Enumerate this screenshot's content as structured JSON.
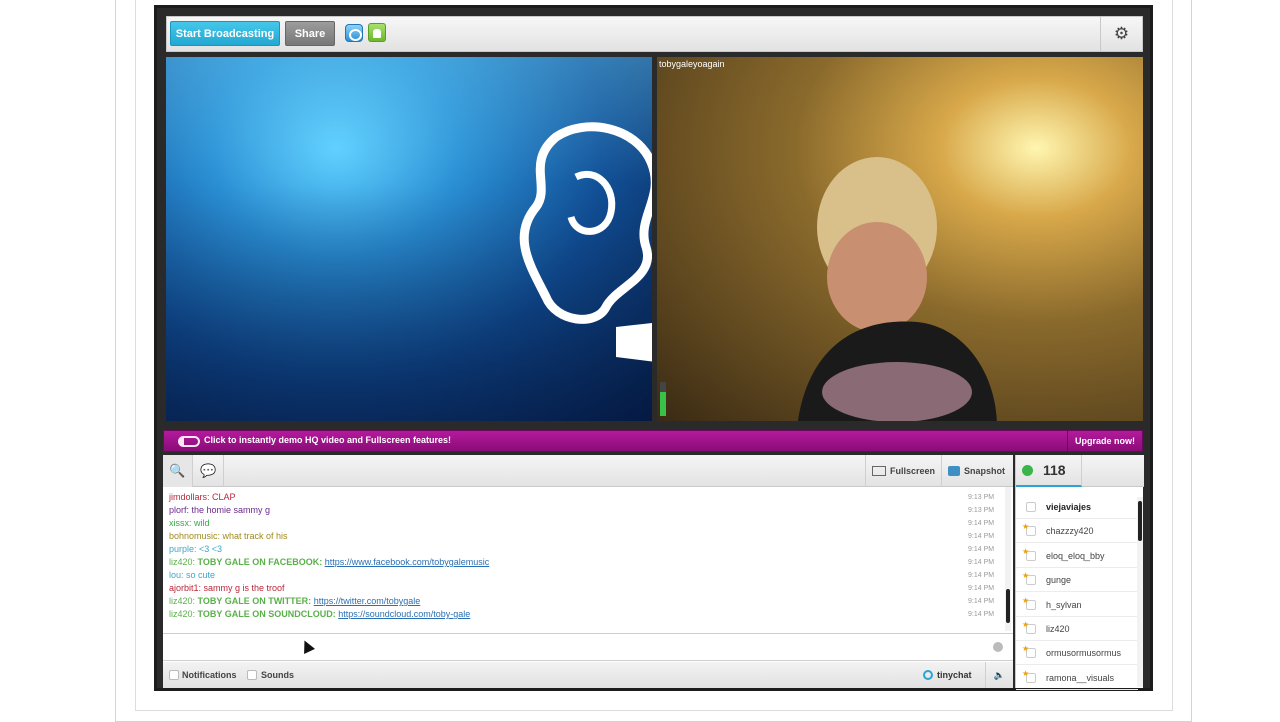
{
  "toolbar": {
    "start_broadcasting": "Start Broadcasting",
    "share": "Share",
    "ios_icon": "ios-app-icon",
    "android_icon": "android-app-icon",
    "settings_icon": "gear-icon"
  },
  "videos": {
    "left_name": "",
    "right_name": "tobygaleyoagain"
  },
  "promo": {
    "text": "Click to instantly demo HQ video and Fullscreen features!",
    "upgrade": "Upgrade now!",
    "accent": "#9c147f"
  },
  "chat_toolbar": {
    "fullscreen": "Fullscreen",
    "snapshot": "Snapshot"
  },
  "messages": [
    {
      "user": "jimdollars:",
      "text": " CLAP",
      "time": "9:13 PM",
      "color": "#b8283a"
    },
    {
      "user": "plorf:",
      "text": " the homie sammy g",
      "time": "9:13 PM",
      "color": "#6a2a8a"
    },
    {
      "user": "xissx:",
      "text": " wild",
      "time": "9:14 PM",
      "color": "#38a848"
    },
    {
      "user": "bohnomusic:",
      "text": " what track of his",
      "time": "9:14 PM",
      "color": "#a08a1e"
    },
    {
      "user": "purple:",
      "text": " <3 <3",
      "time": "9:14 PM",
      "color": "#3aa8c8"
    },
    {
      "user": "liz420:",
      "text": " TOBY GALE ON FACEBOOK:",
      "link": "https://www.facebook.com/tobygalemusic",
      "time": "9:14 PM",
      "color": "#5ab04a"
    },
    {
      "user": "lou:",
      "text": " so cute",
      "time": "9:14 PM",
      "color": "#3aa8c8"
    },
    {
      "user": "ajorbit1:",
      "text": " sammy g is the troof",
      "time": "9:14 PM",
      "color": "#b8283a"
    },
    {
      "user": "liz420:",
      "text": " TOBY GALE ON TWITTER:",
      "link": "https://twitter.com/tobygale",
      "time": "9:14 PM",
      "color": "#5ab04a"
    },
    {
      "user": "liz420:",
      "text": " TOBY GALE ON SOUNDCLOUD:",
      "link": "https://soundcloud.com/toby-gale",
      "time": "9:14 PM",
      "color": "#5ab04a"
    }
  ],
  "input": {
    "value": ""
  },
  "footer": {
    "notifications": "Notifications",
    "sounds": "Sounds",
    "tinychat": "tinychat"
  },
  "users": {
    "count": "118",
    "list": [
      {
        "name": "viejaviajes",
        "self": true,
        "star": false
      },
      {
        "name": "chazzzy420",
        "self": false,
        "star": true
      },
      {
        "name": "eloq_eloq_bby",
        "self": false,
        "star": true
      },
      {
        "name": "gunge",
        "self": false,
        "star": true
      },
      {
        "name": "h_sylvan",
        "self": false,
        "star": true
      },
      {
        "name": "liz420",
        "self": false,
        "star": true
      },
      {
        "name": "ormusormusormus",
        "self": false,
        "star": true
      },
      {
        "name": "ramona__visuals",
        "self": false,
        "star": true
      }
    ]
  }
}
